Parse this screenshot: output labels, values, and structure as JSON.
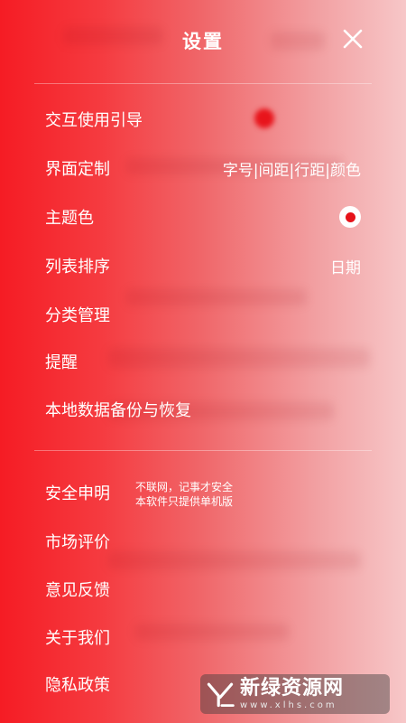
{
  "header": {
    "title": "设置",
    "close_icon": "close-icon"
  },
  "settings": {
    "items": [
      {
        "label": "交互使用引导",
        "value": ""
      },
      {
        "label": "界面定制",
        "value": "字号|间距|行距|颜色"
      },
      {
        "label": "主题色",
        "value": "",
        "control": "radio-selected"
      },
      {
        "label": "列表排序",
        "value": "日期"
      },
      {
        "label": "分类管理",
        "value": ""
      },
      {
        "label": "提醒",
        "value": ""
      },
      {
        "label": "本地数据备份与恢复",
        "value": ""
      }
    ],
    "items2": [
      {
        "label": "安全申明"
      },
      {
        "label": "市场评价"
      },
      {
        "label": "意见反馈"
      },
      {
        "label": "关于我们"
      },
      {
        "label": "隐私政策"
      }
    ],
    "security_note": {
      "line1": "不联网，记事才安全",
      "line2": "本软件只提供单机版"
    }
  },
  "watermark": {
    "text": "新绿资源网",
    "url": "www.xlhs.com"
  },
  "colors": {
    "accent": "#e6131a",
    "text": "#ffffff"
  }
}
